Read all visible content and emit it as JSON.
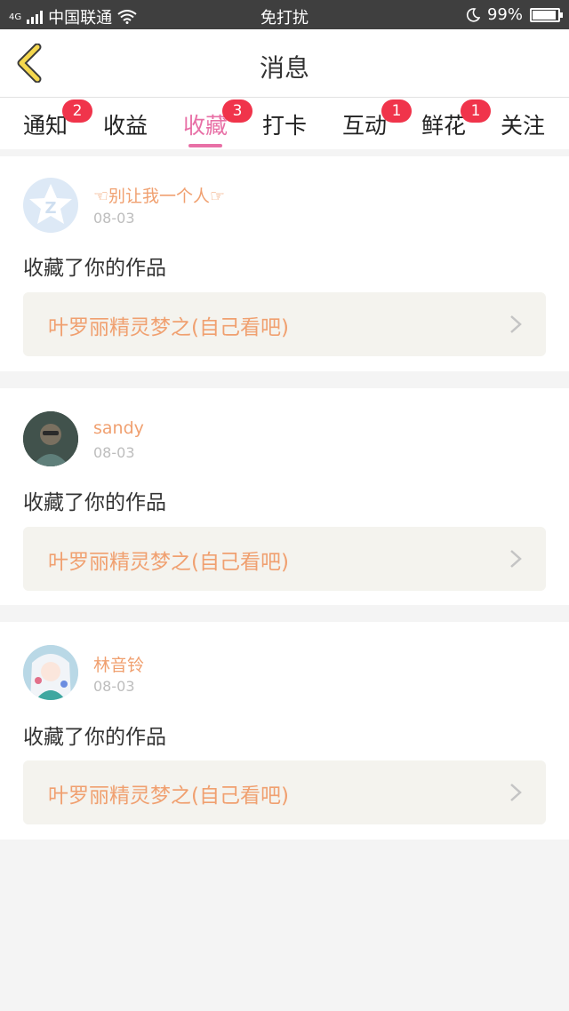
{
  "status_bar": {
    "net": "4G",
    "carrier": "中国联通",
    "center": "免打扰",
    "battery": "99%",
    "battery_level": 0.99
  },
  "header": {
    "title": "消息"
  },
  "tabs": [
    {
      "label": "通知",
      "badge": "2"
    },
    {
      "label": "收益",
      "badge": ""
    },
    {
      "label": "收藏",
      "badge": "3",
      "active": true
    },
    {
      "label": "打卡",
      "badge": ""
    },
    {
      "label": "互动",
      "badge": "1"
    },
    {
      "label": "鲜花",
      "badge": "1"
    },
    {
      "label": "关注",
      "badge": ""
    }
  ],
  "items": [
    {
      "user": "☜别让我一个人☞",
      "date": "08-03",
      "message": "收藏了你的作品",
      "work": "叶罗丽精灵梦之(自己看吧)"
    },
    {
      "user": "sandy",
      "date": "08-03",
      "message": "收藏了你的作品",
      "work": "叶罗丽精灵梦之(自己看吧)"
    },
    {
      "user": "林音铃",
      "date": "08-03",
      "message": "收藏了你的作品",
      "work": "叶罗丽精灵梦之(自己看吧)"
    }
  ],
  "colors": {
    "accent": "#e870a6",
    "badge": "#f0344b",
    "link": "#f0a070",
    "back": "#f5d84e"
  }
}
